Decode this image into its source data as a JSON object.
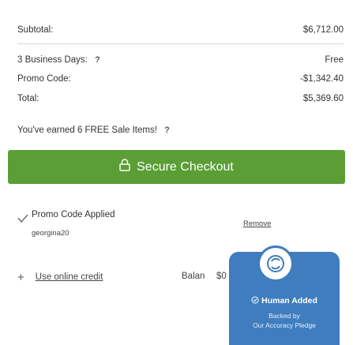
{
  "summary": {
    "subtotal_label": "Subtotal:",
    "subtotal_value": "$6,712.00",
    "shipping_label": "3 Business Days:",
    "shipping_help": "?",
    "shipping_value": "Free",
    "promo_label": "Promo Code:",
    "promo_value": "-$1,342.40",
    "total_label": "Total:",
    "total_value": "$5,369.60"
  },
  "free_items": {
    "text": "You've earned 6 FREE Sale Items!",
    "help": "?"
  },
  "checkout": {
    "label": "Secure Checkout",
    "icon": "lock-icon",
    "color": "#5a9e35"
  },
  "promo": {
    "title": "Promo Code Applied",
    "code": "georgina20",
    "remove_label": "Remove",
    "icon": "check-icon"
  },
  "credit": {
    "add_icon": "+",
    "link_label": "Use online credit",
    "balance_label": "Balan",
    "balance_value": "$0"
  },
  "badge": {
    "title": "Human Added",
    "line1": "Backed by",
    "line2": "Our Accuracy Pledge",
    "color": "#3f7dbf",
    "icon": "human-added-icon"
  }
}
